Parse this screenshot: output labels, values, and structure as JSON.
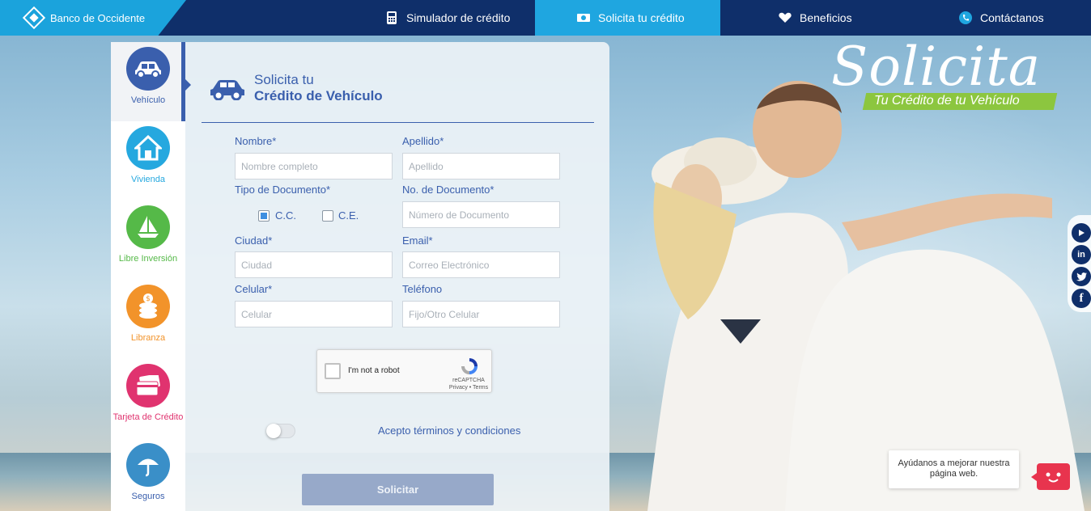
{
  "brand": {
    "name": "Banco de Occidente"
  },
  "nav": {
    "items": [
      {
        "label": "Simulador de crédito",
        "icon": "calculator-icon"
      },
      {
        "label": "Solicita tu crédito",
        "icon": "money-icon"
      },
      {
        "label": "Beneficios",
        "icon": "heart-hands-icon"
      },
      {
        "label": "Contáctanos",
        "icon": "phone-icon"
      }
    ],
    "active_index": 1
  },
  "categories": [
    {
      "label": "Vehículo",
      "icon": "car-icon",
      "color": "#3a5fad"
    },
    {
      "label": "Vivienda",
      "icon": "house-icon",
      "color": "#25a8df"
    },
    {
      "label": "Libre Inversión",
      "icon": "sailboat-icon",
      "color": "#55b948"
    },
    {
      "label": "Libranza",
      "icon": "coins-icon",
      "color": "#f2932a"
    },
    {
      "label": "Tarjeta de Crédito",
      "icon": "credit-card-icon",
      "color": "#e0336f"
    },
    {
      "label": "Seguros",
      "icon": "umbrella-icon",
      "color": "#3a5fad"
    }
  ],
  "form": {
    "title_line1": "Solicita tu",
    "title_line2": "Crédito de Vehículo",
    "fields": {
      "nombre": {
        "label": "Nombre*",
        "placeholder": "Nombre completo"
      },
      "apellido": {
        "label": "Apellido*",
        "placeholder": "Apellido"
      },
      "tipo_documento": {
        "label": "Tipo de Documento*",
        "options": [
          "C.C.",
          "C.E."
        ],
        "selected": "C.C."
      },
      "num_documento": {
        "label": "No. de Documento*",
        "placeholder": "Número de Documento"
      },
      "ciudad": {
        "label": "Ciudad*",
        "placeholder": "Ciudad"
      },
      "email": {
        "label": "Email*",
        "placeholder": "Correo Electrónico"
      },
      "celular": {
        "label": "Celular*",
        "placeholder": "Celular"
      },
      "telefono": {
        "label": "Teléfono",
        "placeholder": "Fijo/Otro Celular"
      }
    },
    "captcha": {
      "text": "I'm not a robot",
      "brand": "reCAPTCHA",
      "links": "Privacy • Terms"
    },
    "terms_label": "Acepto términos y condiciones",
    "terms_accepted": false,
    "submit_label": "Solicitar"
  },
  "hero": {
    "line1": "Solicita",
    "line2": "Tu Crédito de tu Vehículo"
  },
  "social": [
    "play-icon",
    "linkedin-icon",
    "twitter-icon",
    "facebook-icon"
  ],
  "feedback": {
    "text": "Ayúdanos a mejorar nuestra página web."
  }
}
